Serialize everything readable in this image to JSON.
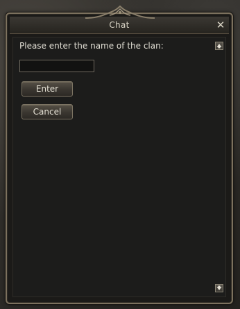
{
  "window": {
    "title": "Chat",
    "close_label": "✕"
  },
  "dialog": {
    "prompt": "Please enter the name of the clan:",
    "clan_name_value": "",
    "enter_label": "Enter",
    "cancel_label": "Cancel"
  },
  "icons": {
    "close": "close-icon",
    "scroll_up": "arrow-up-icon",
    "scroll_down": "arrow-down-icon",
    "crest": "ornament-icon"
  },
  "colors": {
    "frame": "#7c715e",
    "panel": "#1c1c1b",
    "text": "#e0ddd3"
  }
}
